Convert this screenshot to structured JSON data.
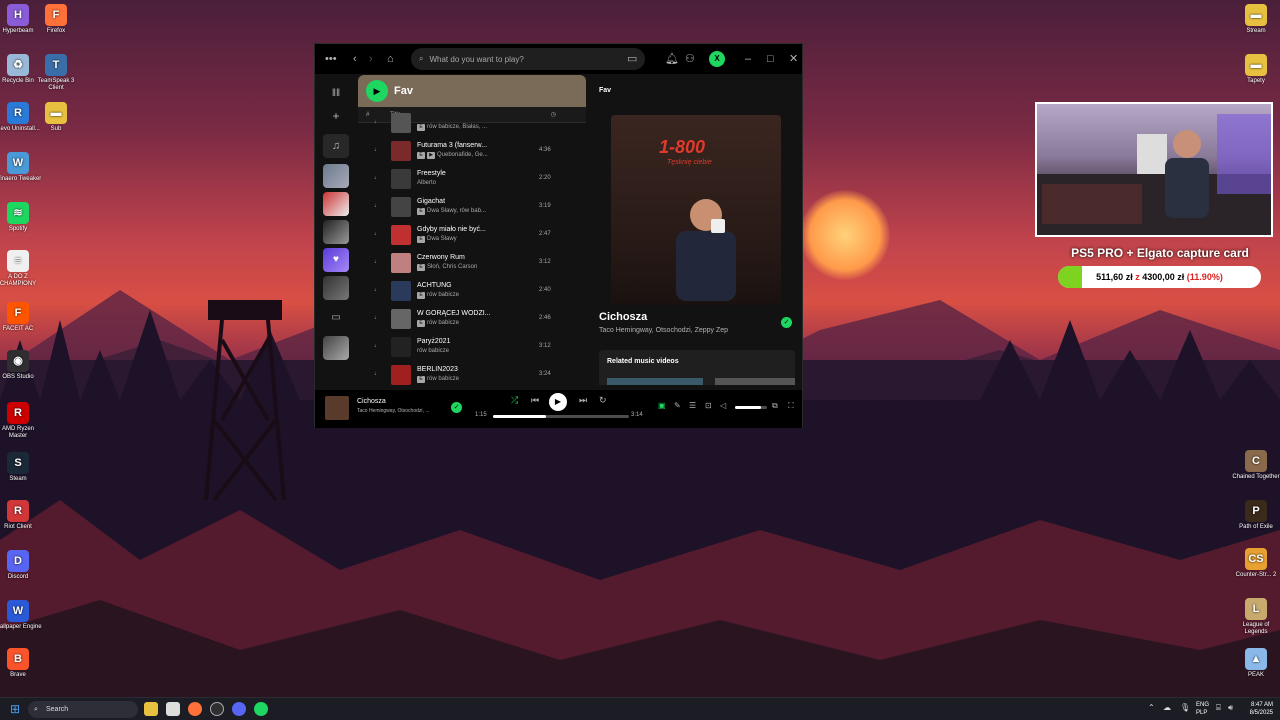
{
  "desktop": {
    "left_icons": [
      {
        "label": "Hyperbeam",
        "icon": "hyperbeam-icon",
        "color": "#8a5cd8",
        "glyph": "H"
      },
      {
        "label": "Firefox",
        "icon": "firefox-icon",
        "color": "#ff7139",
        "glyph": "F"
      },
      {
        "label": "Recycle Bin",
        "icon": "recycle-bin-icon",
        "color": "#9ab8d8",
        "glyph": "♻"
      },
      {
        "label": "TeamSpeak 3 Client",
        "icon": "teamspeak-icon",
        "color": "#3a6ea8",
        "glyph": "T"
      },
      {
        "label": "Revo Uninstall...",
        "icon": "revo-icon",
        "color": "#2a7ad8",
        "glyph": "R"
      },
      {
        "label": "Sub",
        "icon": "folder-icon",
        "color": "#e8c040",
        "glyph": "▬"
      },
      {
        "label": "Winaero Tweaker",
        "icon": "winaero-icon",
        "color": "#4a9ad8",
        "glyph": "W"
      },
      {
        "label": "Spotify",
        "icon": "spotify-icon",
        "color": "#1ed760",
        "glyph": "≋"
      },
      {
        "label": "A DO Z CHAMPIONY",
        "icon": "document-icon",
        "color": "#f0f0f0",
        "glyph": "≡"
      },
      {
        "label": "FACEIT AC",
        "icon": "faceit-icon",
        "color": "#ff5500",
        "glyph": "F"
      },
      {
        "label": "OBS Studio",
        "icon": "obs-icon",
        "color": "#302e31",
        "glyph": "◉"
      },
      {
        "label": "AMD Ryzen Master",
        "icon": "amd-icon",
        "color": "#c00",
        "glyph": "R"
      },
      {
        "label": "Steam",
        "icon": "steam-icon",
        "color": "#1b2838",
        "glyph": "S"
      },
      {
        "label": "Riot Client",
        "icon": "riot-icon",
        "color": "#d13639",
        "glyph": "R"
      },
      {
        "label": "Discord",
        "icon": "discord-icon",
        "color": "#5865f2",
        "glyph": "D"
      },
      {
        "label": "Wallpaper Engine",
        "icon": "wallpaper-engine-icon",
        "color": "#2a5ad8",
        "glyph": "W"
      },
      {
        "label": "Brave",
        "icon": "brave-icon",
        "color": "#fb542b",
        "glyph": "B"
      }
    ],
    "right_icons": [
      {
        "label": "Stream",
        "icon": "folder-icon",
        "color": "#e8c040",
        "glyph": "▬"
      },
      {
        "label": "Tapety",
        "icon": "folder-icon",
        "color": "#e8c040",
        "glyph": "▬"
      },
      {
        "label": "Chained Together",
        "icon": "chained-together-icon",
        "color": "#8a6a4a",
        "glyph": "C"
      },
      {
        "label": "Path of Exile",
        "icon": "path-of-exile-icon",
        "color": "#3a2a1a",
        "glyph": "P"
      },
      {
        "label": "Counter-Str... 2",
        "icon": "counter-strike-icon",
        "color": "#e8a030",
        "glyph": "CS"
      },
      {
        "label": "League of Legends",
        "icon": "league-icon",
        "color": "#c8aa6e",
        "glyph": "L"
      },
      {
        "label": "PEAK",
        "icon": "peak-icon",
        "color": "#8ab8e8",
        "glyph": "▲"
      }
    ]
  },
  "spotify": {
    "search_placeholder": "What do you want to play?",
    "avatar_letter": "X",
    "playlist_title": "Fav",
    "col_num": "#",
    "col_title": "Title",
    "tracks": [
      {
        "num": "",
        "title": "",
        "artists": "rów babicze, Białas, ...",
        "explicit": true,
        "video": false,
        "duration": "",
        "color": "#555"
      },
      {
        "num": "",
        "title": "Futurama 3 (fanserw...",
        "artists": "Quebonafide, Ge...",
        "explicit": true,
        "video": true,
        "duration": "4:36",
        "color": "#7a2a2a"
      },
      {
        "num": "",
        "title": "Freestyle",
        "artists": "Alberto",
        "explicit": false,
        "video": false,
        "duration": "2:20",
        "color": "#3a3a3a"
      },
      {
        "num": "",
        "title": "Gigachat",
        "artists": "Dwa Sławy, rów bab...",
        "explicit": true,
        "video": false,
        "duration": "3:19",
        "color": "#444"
      },
      {
        "num": "",
        "title": "Gdyby miało nie być...",
        "artists": "Dwa Sławy",
        "explicit": true,
        "video": false,
        "duration": "2:47",
        "color": "#c03030"
      },
      {
        "num": "",
        "title": "Czerwony Rum",
        "artists": "Słoń, Chris Carson",
        "explicit": true,
        "video": false,
        "duration": "3:12",
        "color": "#c08080"
      },
      {
        "num": "",
        "title": "ACHTUNG",
        "artists": "rów babicze",
        "explicit": true,
        "video": false,
        "duration": "2:40",
        "color": "#2a3a5a"
      },
      {
        "num": "",
        "title": "W GORĄCEJ WODZI...",
        "artists": "rów babicze",
        "explicit": true,
        "video": false,
        "duration": "2:46",
        "color": "#666"
      },
      {
        "num": "",
        "title": "Paryż2021",
        "artists": "rów babicze",
        "explicit": false,
        "video": false,
        "duration": "3:12",
        "color": "#222"
      },
      {
        "num": "",
        "title": "BERLIN2023",
        "artists": "rów babicze",
        "explicit": true,
        "video": false,
        "duration": "3:24",
        "color": "#a02020"
      }
    ],
    "now_playing_label": "Fav",
    "cover_title": "1-800",
    "cover_subtitle": "Tęsknię ciebie",
    "song_title": "Cichosza",
    "song_artists": "Taco Hemingway, Otsochodzi, Zeppy Zep",
    "related_label": "Related music videos",
    "player": {
      "title": "Cichosza",
      "artists": "Taco Hemingway, Otsochodzi, ...",
      "elapsed": "1:15",
      "total": "3:14",
      "progress": 0.39,
      "volume": 0.8
    }
  },
  "overlay": {
    "title": "PS5 PRO + Elgato capture card",
    "raised": "511,60 zł",
    "sep": "z",
    "goal": "4300,00 zł",
    "percent": "(11.90%)",
    "fraction": 0.119
  },
  "taskbar": {
    "search_label": "Search",
    "lang_top": "ENG",
    "lang_bottom": "PLP",
    "time": "8:47 AM",
    "date": "8/5/2025"
  },
  "colors": {
    "spotify_green": "#1ed760",
    "window_bg": "#121212",
    "header_brown": "#7a6a58"
  }
}
